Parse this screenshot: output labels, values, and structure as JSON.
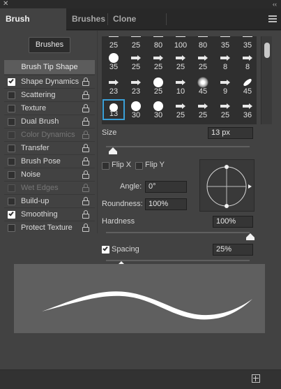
{
  "window": {
    "close_glyph": "✕",
    "collapse_glyph": "‹‹"
  },
  "tabs": [
    {
      "label": "Brush Settings",
      "active": true
    },
    {
      "label": "Brushes",
      "active": false
    },
    {
      "label": "Clone Source",
      "active": false
    }
  ],
  "brushes_button": "Brushes",
  "tip_shape_label": "Brush Tip Shape",
  "options": [
    {
      "label": "Shape Dynamics",
      "checked": true,
      "disabled": false
    },
    {
      "label": "Scattering",
      "checked": false,
      "disabled": false
    },
    {
      "label": "Texture",
      "checked": false,
      "disabled": false
    },
    {
      "label": "Dual Brush",
      "checked": false,
      "disabled": false
    },
    {
      "label": "Color Dynamics",
      "checked": false,
      "disabled": true
    },
    {
      "label": "Transfer",
      "checked": false,
      "disabled": false
    },
    {
      "label": "Brush Pose",
      "checked": false,
      "disabled": false
    },
    {
      "label": "Noise",
      "checked": false,
      "disabled": false
    },
    {
      "label": "Wet Edges",
      "checked": false,
      "disabled": true
    },
    {
      "label": "Build-up",
      "checked": false,
      "disabled": false
    },
    {
      "label": "Smoothing",
      "checked": true,
      "disabled": false
    },
    {
      "label": "Protect Texture",
      "checked": false,
      "disabled": false
    }
  ],
  "brush_grid": [
    [
      "25",
      "25",
      "80",
      "100",
      "80",
      "35",
      "35"
    ],
    [
      "35",
      "25",
      "25",
      "25",
      "25",
      "8",
      "8"
    ],
    [
      "23",
      "23",
      "25",
      "10",
      "45",
      "9",
      "45"
    ],
    [
      "13",
      "30",
      "30",
      "25",
      "25",
      "25",
      "36"
    ]
  ],
  "brush_thumbs": [
    [
      "flat",
      "flat",
      "flat",
      "flat",
      "flat",
      "flat",
      "flat"
    ],
    [
      "round",
      "pen",
      "arrow",
      "arrow",
      "arrow",
      "arrow",
      "arrow"
    ],
    [
      "arrow",
      "arrow",
      "round",
      "arrow",
      "soft",
      "arrow",
      "leaf"
    ],
    [
      "round-small",
      "round",
      "round",
      "pen",
      "arrow",
      "arrow",
      "arrow"
    ]
  ],
  "selected_brush": "13",
  "size": {
    "label": "Size",
    "value": "13 px",
    "level": 0.03
  },
  "flip_x": {
    "label": "Flip X",
    "checked": false
  },
  "flip_y": {
    "label": "Flip Y",
    "checked": false
  },
  "angle": {
    "label": "Angle:",
    "value": "0°"
  },
  "roundness": {
    "label": "Roundness:",
    "value": "100%"
  },
  "hardness": {
    "label": "Hardness",
    "value": "100%",
    "level": 1.0
  },
  "spacing": {
    "label": "Spacing",
    "value": "25%",
    "checked": true,
    "level": 0.09
  },
  "colors": {
    "accent": "#3aa0d8",
    "panel": "#424242",
    "preview_bg": "#5f5f5f"
  }
}
